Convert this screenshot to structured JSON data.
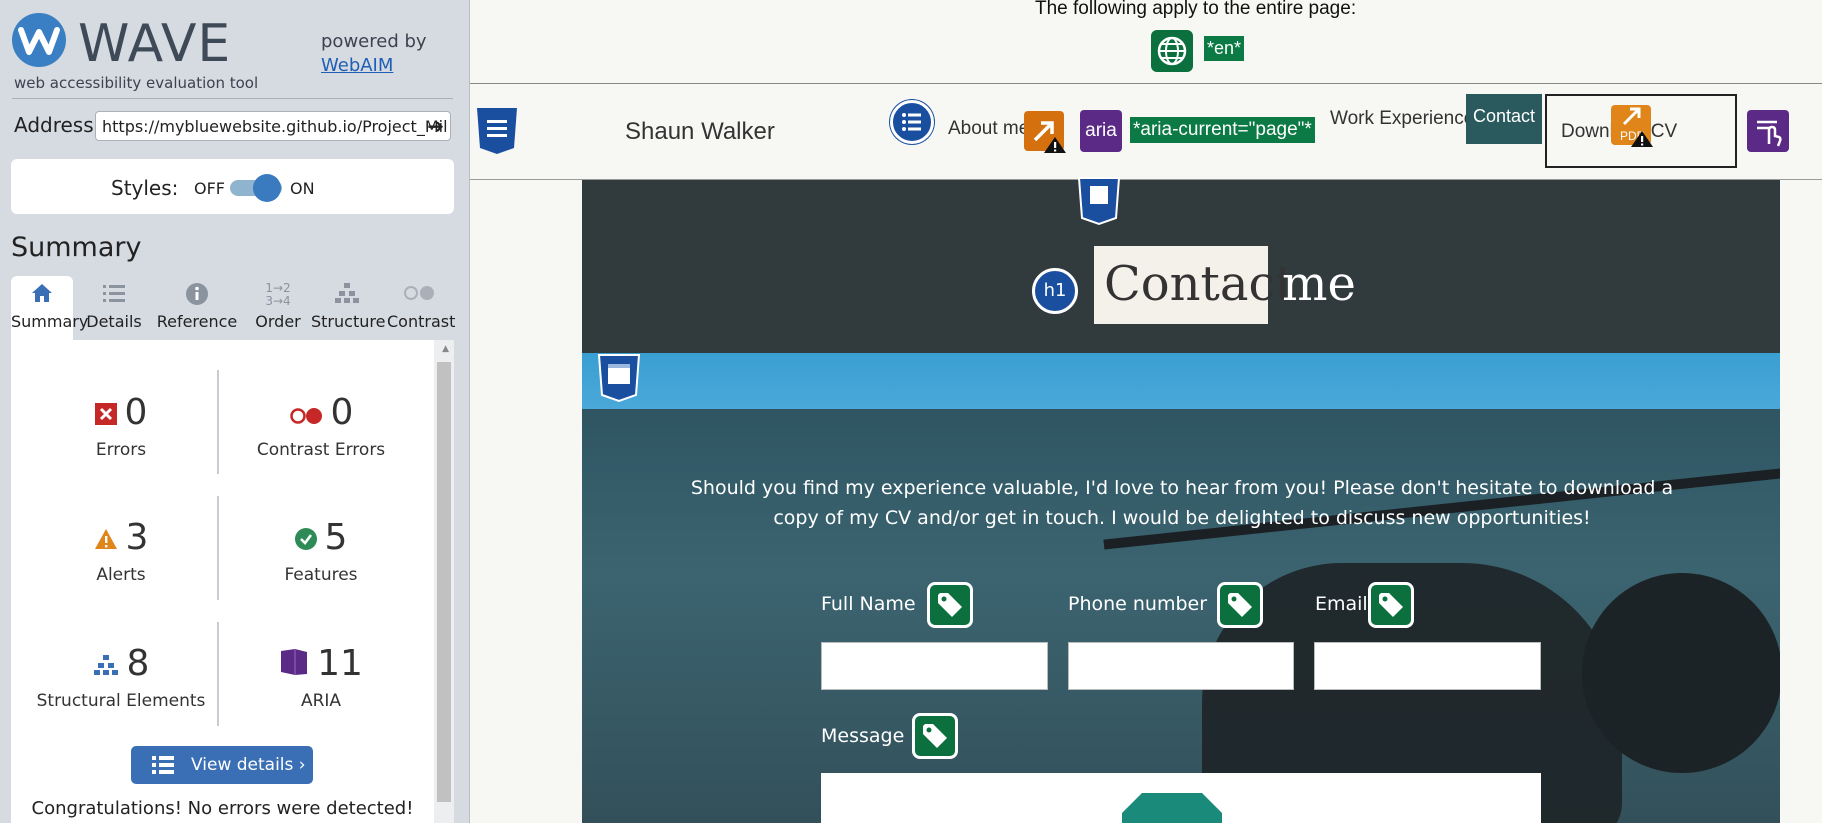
{
  "wave": {
    "logo_text": "WAVE",
    "subtitle": "web accessibility evaluation tool",
    "powered_by": "powered by",
    "webaim_link": "WebAIM",
    "address_label": "Address:",
    "address_value": "https://mybluewebsite.github.io/Project_Mil",
    "go_icon": "arrow-right-icon",
    "styles_label": "Styles:",
    "styles_off": "OFF",
    "styles_on": "ON",
    "styles_enabled": true,
    "summary_title": "Summary",
    "tabs": [
      {
        "label": "Summary",
        "icon": "home-icon",
        "active": true
      },
      {
        "label": "Details",
        "icon": "list-icon",
        "active": false
      },
      {
        "label": "Reference",
        "icon": "info-icon",
        "active": false
      },
      {
        "label": "Order",
        "icon": "order-icon",
        "active": false
      },
      {
        "label": "Structure",
        "icon": "structure-icon",
        "active": false
      },
      {
        "label": "Contrast",
        "icon": "contrast-icon",
        "active": false
      }
    ],
    "stats": {
      "errors": {
        "count": "0",
        "label": "Errors"
      },
      "contrast_errors": {
        "count": "0",
        "label": "Contrast Errors"
      },
      "alerts": {
        "count": "3",
        "label": "Alerts"
      },
      "features": {
        "count": "5",
        "label": "Features"
      },
      "structural": {
        "count": "8",
        "label": "Structural Elements"
      },
      "aria": {
        "count": "11",
        "label": "ARIA"
      }
    },
    "view_details": "View details ›",
    "congrats": "Congratulations! No errors were detected!"
  },
  "page": {
    "applies_text": "The following apply to the entire page:",
    "lang_tag": "*en*",
    "brand": "Shaun Walker",
    "nav_about": "About me",
    "aria_badge": "aria",
    "aria_current_tag": "*aria-current=\"page\"*",
    "nav_work": "Work Experience",
    "nav_contact": "Contact",
    "nav_download": "Download CV",
    "pdf_label": "PDF",
    "h1_badge": "h1",
    "heading_contact": "Contact",
    "heading_me": "me",
    "intro": "Should you find my experience valuable, I'd love to hear from you! Please don't hesitate to download a copy of my CV and/or get in touch. I would be delighted to discuss new opportunities!",
    "form": {
      "full_name": "Full Name",
      "phone": "Phone number",
      "email": "Email",
      "message": "Message"
    }
  },
  "colors": {
    "wave_blue": "#3a6fb5",
    "feature_green": "#0b6f3e",
    "aria_purple": "#5b2a86",
    "alert_orange": "#e0851a",
    "error_red": "#c62828",
    "dark_band": "#313a3c",
    "nav_contact_bg": "#2b5a5e"
  }
}
